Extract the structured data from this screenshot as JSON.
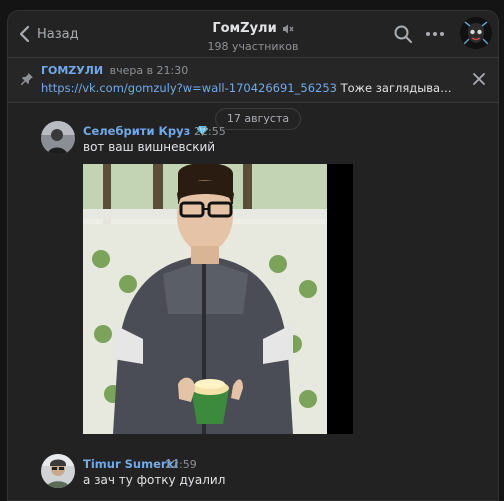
{
  "header": {
    "back_label": "Назад",
    "title": "ГомZули",
    "subtitle": "198 участников"
  },
  "pinned": {
    "author": "ГОМZУЛИ",
    "time": "вчера в 21:30",
    "link": "https://vk.com/gomzuly?w=wall-170426691_56253",
    "text": "Тоже заглядывайте туда ..."
  },
  "date_separator": "17 августа",
  "messages": [
    {
      "author": "Селебрити Круз",
      "time": "22:55",
      "text": "вот ваш вишневский",
      "has_photo": true
    },
    {
      "author": "Timur Sumerki",
      "time": "22:59",
      "text": "а зач ту фотку дуалил"
    }
  ],
  "icons": {
    "back": "chevron-left-icon",
    "muted": "speaker-muted-icon",
    "search": "search-icon",
    "more": "more-dots-icon",
    "pin": "pin-icon",
    "close": "close-icon",
    "verified": "diamond-icon"
  },
  "colors": {
    "accent": "#71aaeb",
    "background": "#222222",
    "text": "#e1e3e6",
    "secondary": "#8d9195"
  }
}
